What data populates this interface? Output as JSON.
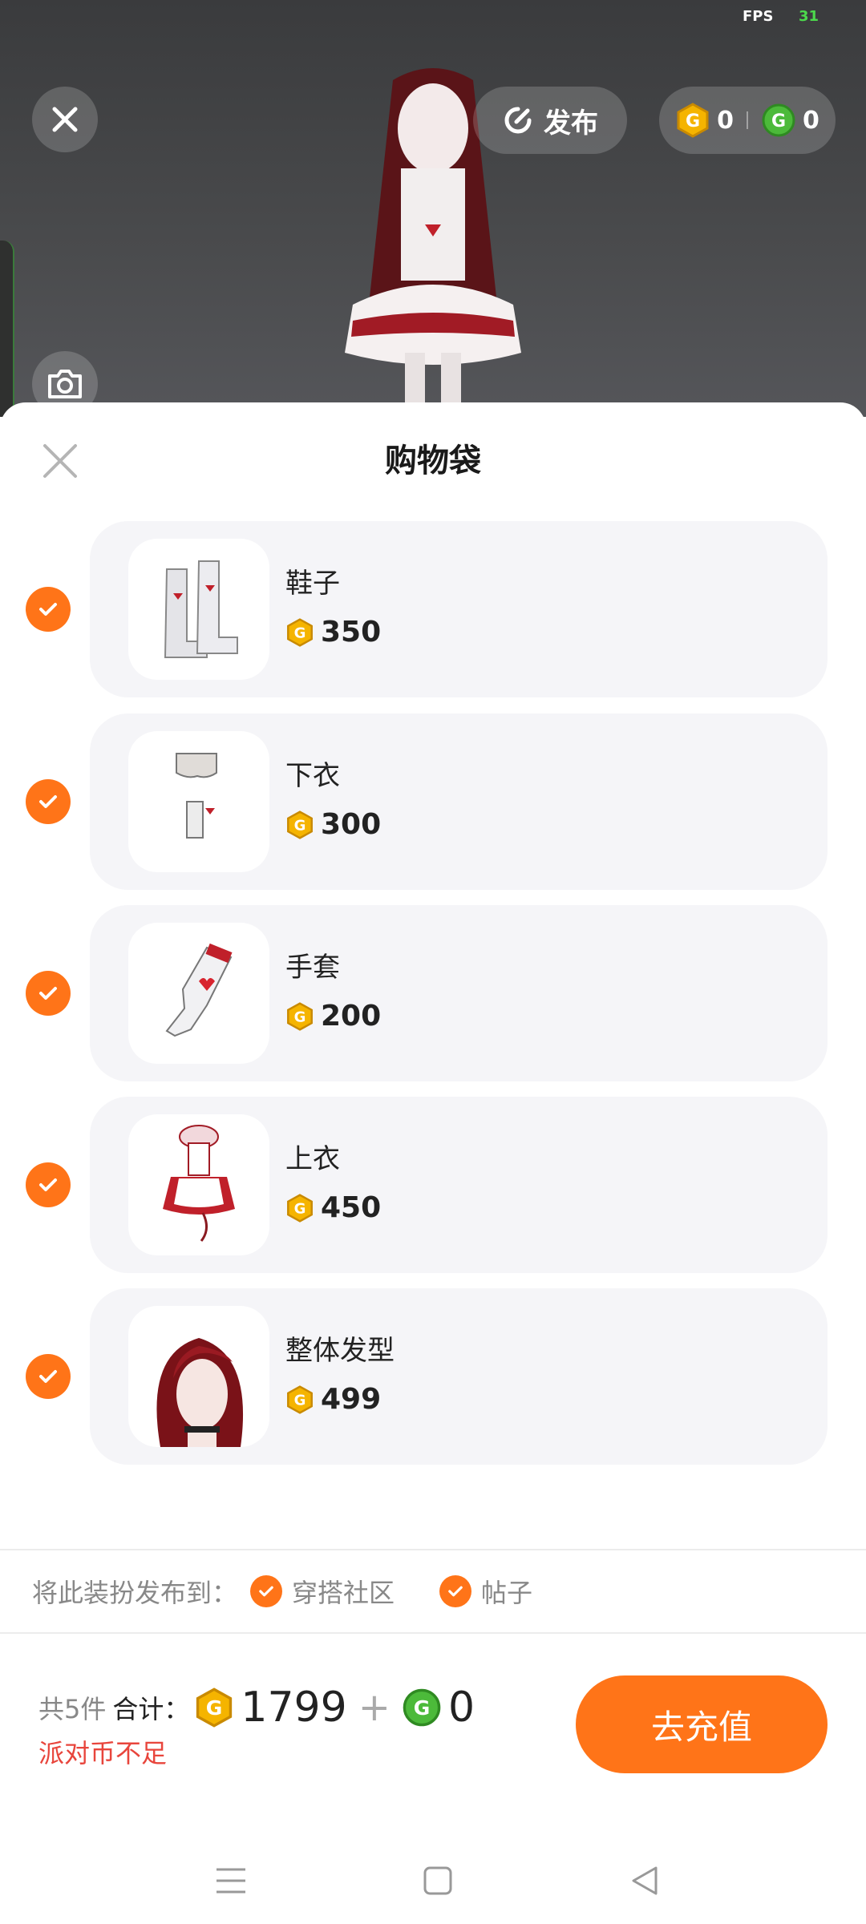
{
  "status": {
    "fps_label": "FPS",
    "fps_value": "31"
  },
  "scene": {
    "publish_label": "发布",
    "gold_balance": "0",
    "green_balance": "0"
  },
  "sheet": {
    "title": "购物袋",
    "items": [
      {
        "name": "鞋子",
        "price": "350",
        "icon": "boots-icon"
      },
      {
        "name": "下衣",
        "price": "300",
        "icon": "bottoms-icon"
      },
      {
        "name": "手套",
        "price": "200",
        "icon": "glove-icon"
      },
      {
        "name": "上衣",
        "price": "450",
        "icon": "dress-icon"
      },
      {
        "name": "整体发型",
        "price": "499",
        "icon": "hair-icon"
      }
    ]
  },
  "publish_to": {
    "label": "将此装扮发布到：",
    "options": [
      "穿搭社区",
      "帖子"
    ]
  },
  "footer": {
    "count": "共5件",
    "sum_label": "合计：",
    "gold_total": "1799",
    "plus": "+",
    "green_total": "0",
    "warning": "派对币不足",
    "recharge_label": "去充值"
  },
  "colors": {
    "accent": "#ff7418",
    "gold_coin": "#f5b400",
    "green_coin": "#4cba3a",
    "warning": "#e8453c"
  }
}
